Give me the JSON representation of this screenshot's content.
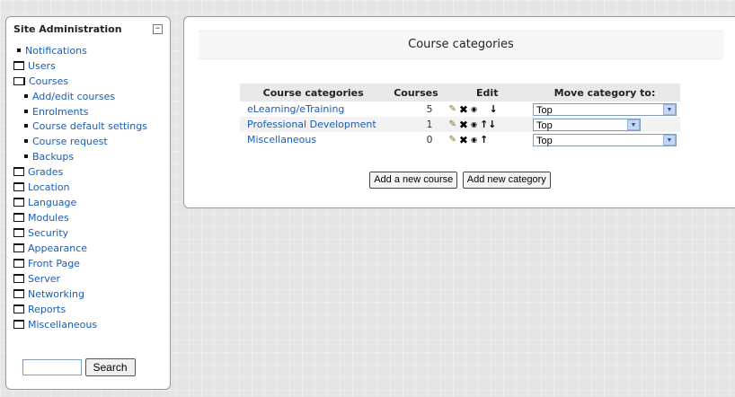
{
  "sidebar": {
    "title": "Site Administration",
    "hide_label": "−",
    "items": [
      {
        "label": "Notifications",
        "type": "leaf"
      },
      {
        "label": "Users",
        "type": "folder"
      },
      {
        "label": "Courses",
        "type": "folder-open"
      },
      {
        "label": "Add/edit courses",
        "type": "leaf-sub"
      },
      {
        "label": "Enrolments",
        "type": "leaf-sub"
      },
      {
        "label": "Course default settings",
        "type": "leaf-sub"
      },
      {
        "label": "Course request",
        "type": "leaf-sub"
      },
      {
        "label": "Backups",
        "type": "leaf-sub"
      },
      {
        "label": "Grades",
        "type": "folder"
      },
      {
        "label": "Location",
        "type": "folder"
      },
      {
        "label": "Language",
        "type": "folder"
      },
      {
        "label": "Modules",
        "type": "folder"
      },
      {
        "label": "Security",
        "type": "folder"
      },
      {
        "label": "Appearance",
        "type": "folder"
      },
      {
        "label": "Front Page",
        "type": "folder"
      },
      {
        "label": "Server",
        "type": "folder"
      },
      {
        "label": "Networking",
        "type": "folder"
      },
      {
        "label": "Reports",
        "type": "folder"
      },
      {
        "label": "Miscellaneous",
        "type": "folder"
      }
    ],
    "search": {
      "value": "",
      "button": "Search"
    }
  },
  "main": {
    "heading": "Course categories",
    "table": {
      "headers": [
        "Course categories",
        "Courses",
        "Edit",
        "Move category to:"
      ],
      "rows": [
        {
          "name": "eLearning/eTraining",
          "courses": "5",
          "arrows": "↓",
          "move_to": "Top"
        },
        {
          "name": "Professional Development",
          "courses": "1",
          "arrows": "↑↓",
          "move_to": "Top"
        },
        {
          "name": "Miscellaneous",
          "courses": "0",
          "arrows": "↑",
          "move_to": "Top"
        }
      ]
    },
    "buttons": {
      "add_course": "Add a new course",
      "add_category": "Add new category"
    }
  },
  "icons": {
    "edit": "✎",
    "delete": "✖",
    "hide": "◉",
    "dropdown": "▼"
  }
}
